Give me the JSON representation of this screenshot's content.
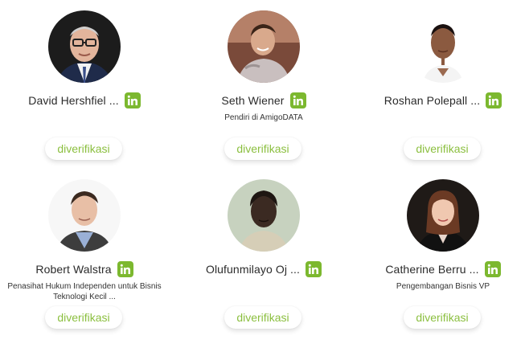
{
  "brand_color": "#7cb82f",
  "verify_color": "#8bbf3f",
  "people": [
    {
      "name": "David Hershfiel ...",
      "subtitle": "",
      "verify_label": "diverifikasi",
      "icon": "linkedin-icon"
    },
    {
      "name": "Seth Wiener",
      "subtitle": "Pendiri di AmigoDATA",
      "verify_label": "diverifikasi",
      "icon": "linkedin-icon"
    },
    {
      "name": "Roshan Polepall ...",
      "subtitle": "",
      "verify_label": "diverifikasi",
      "icon": "linkedin-icon"
    },
    {
      "name": "Robert Walstra",
      "subtitle": "Penasihat Hukum Independen untuk Bisnis Teknologi Kecil ...",
      "verify_label": "diverifikasi",
      "icon": "linkedin-icon"
    },
    {
      "name": "Olufunmilayo Oj ...",
      "subtitle": "",
      "verify_label": "diverifikasi",
      "icon": "linkedin-icon"
    },
    {
      "name": "Catherine Berru ...",
      "subtitle": "Pengembangan Bisnis VP",
      "verify_label": "diverifikasi",
      "icon": "linkedin-icon"
    }
  ]
}
